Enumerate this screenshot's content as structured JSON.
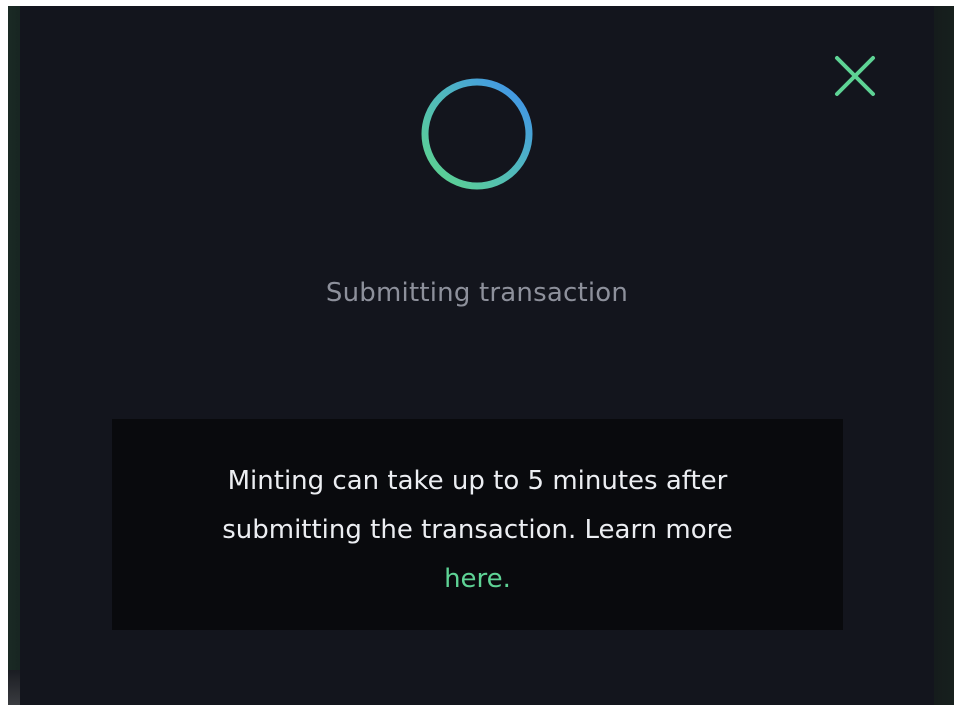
{
  "modal": {
    "close_icon": "close-icon",
    "spinner_icon": "loading-spinner-icon",
    "status": "Submitting transaction",
    "info": {
      "message": "Minting can take up to 5 minutes after submitting the transaction. Learn more",
      "link_text": "here."
    }
  },
  "colors": {
    "background": "#13151d",
    "info_box": "#090a0d",
    "accent_green": "#5ed395",
    "accent_blue": "#4a9eea",
    "status_text": "#8d909b",
    "body_text": "#eceef2"
  }
}
